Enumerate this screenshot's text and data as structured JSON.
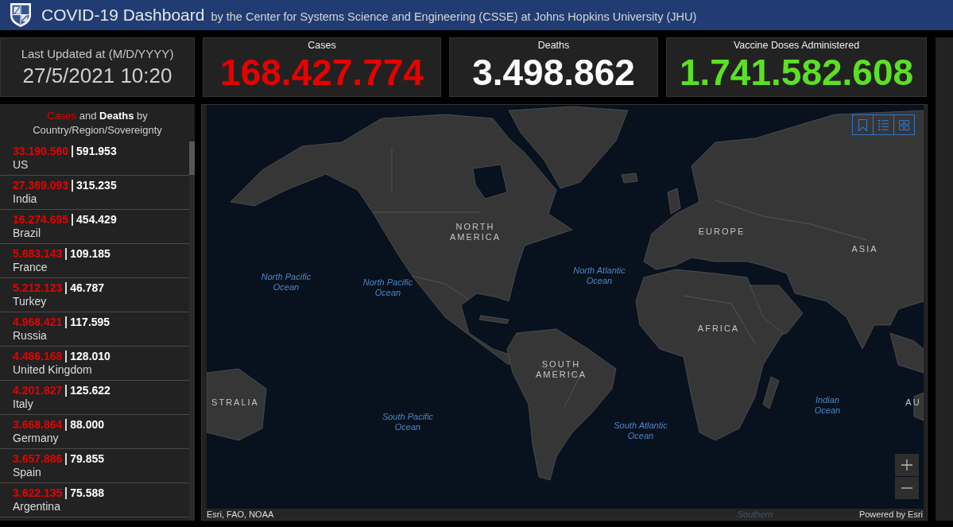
{
  "header": {
    "title": "COVID-19 Dashboard",
    "subtitle": "by the Center for Systems Science and Engineering (CSSE) at Johns Hopkins University (JHU)"
  },
  "last_updated": {
    "label": "Last Updated at (M/D/YYYY)",
    "value": "27/5/2021 10:20"
  },
  "stats": [
    {
      "label": "Cases",
      "value": "168.427.774",
      "color": "#e60000"
    },
    {
      "label": "Deaths",
      "value": "3.498.862",
      "color": "#ffffff"
    },
    {
      "label": "Vaccine Doses Administered",
      "value": "1.741.582.608",
      "color": "#5ce023"
    }
  ],
  "country_list": {
    "title": "**Cases** and **Deaths** by Country/Region/Sovereignty",
    "rows": [
      {
        "cases": "33.190.560",
        "deaths": "591.953",
        "name": "US"
      },
      {
        "cases": "27.369.093",
        "deaths": "315.235",
        "name": "India"
      },
      {
        "cases": "16.274.695",
        "deaths": "454.429",
        "name": "Brazil"
      },
      {
        "cases": "5.683.143",
        "deaths": "109.185",
        "name": "France"
      },
      {
        "cases": "5.212.123",
        "deaths": "46.787",
        "name": "Turkey"
      },
      {
        "cases": "4.968.421",
        "deaths": "117.595",
        "name": "Russia"
      },
      {
        "cases": "4.486.168",
        "deaths": "128.010",
        "name": "United Kingdom"
      },
      {
        "cases": "4.201.827",
        "deaths": "125.622",
        "name": "Italy"
      },
      {
        "cases": "3.668.864",
        "deaths": "88.000",
        "name": "Germany"
      },
      {
        "cases": "3.657.886",
        "deaths": "79.855",
        "name": "Spain"
      },
      {
        "cases": "3.622.135",
        "deaths": "75.588",
        "name": "Argentina"
      }
    ]
  },
  "map": {
    "labels": [
      {
        "kind": "continent",
        "text": "NORTH AMERICA"
      },
      {
        "kind": "continent",
        "text": "EUROPE"
      },
      {
        "kind": "continent",
        "text": "ASIA"
      },
      {
        "kind": "continent",
        "text": "AFRICA"
      },
      {
        "kind": "continent",
        "text": "SOUTH AMERICA"
      },
      {
        "kind": "continent",
        "text": "STRALIA"
      },
      {
        "kind": "continent",
        "text": "AU"
      },
      {
        "kind": "ocean",
        "text": "North Pacific Ocean"
      },
      {
        "kind": "ocean",
        "text": "North Pacific Ocean"
      },
      {
        "kind": "ocean",
        "text": "North Atlantic Ocean"
      },
      {
        "kind": "ocean",
        "text": "South Pacific Ocean"
      },
      {
        "kind": "ocean",
        "text": "South Atlantic Ocean"
      },
      {
        "kind": "ocean",
        "text": "Indian Ocean"
      },
      {
        "kind": "ocean",
        "text": "Southern"
      }
    ],
    "attribution": "Esri, FAO, NOAA",
    "powered_by": "Powered by Esri"
  }
}
